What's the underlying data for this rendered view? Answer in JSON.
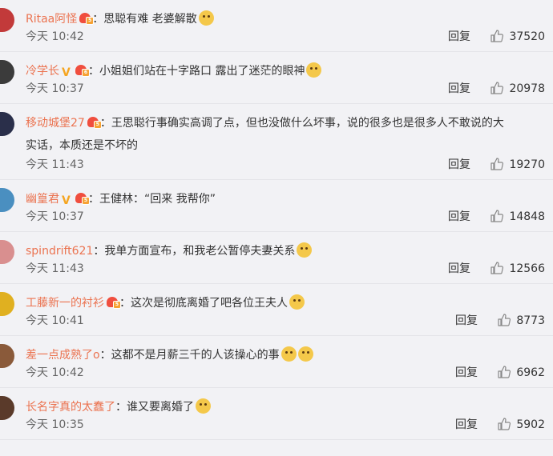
{
  "reply_label": "回复",
  "comments": [
    {
      "user": "Ritaa阿怪",
      "vip": true,
      "vip_level": "5",
      "verified": false,
      "text": "思聪有难 老婆解散",
      "emojis": 1,
      "time": "今天 10:42",
      "likes": "37520",
      "avatar_color": "#c23a3a"
    },
    {
      "user": "冷学长",
      "vip": true,
      "vip_level": "6",
      "verified": true,
      "text": "小姐姐们站在十字路口 露出了迷茫的眼神",
      "emojis": 1,
      "time": "今天 10:37",
      "likes": "20978",
      "avatar_color": "#3b3b3b"
    },
    {
      "user": "移动城堡27",
      "vip": true,
      "vip_level": "5",
      "verified": false,
      "text": "王思聪行事确实高调了点，但也没做什么坏事，说的很多也是很多人不敢说的大",
      "text2": "实话，本质还是不坏的",
      "emojis": 0,
      "time": "今天 11:43",
      "likes": "19270",
      "avatar_color": "#2a2f4a"
    },
    {
      "user": "幽篁君",
      "vip": true,
      "vip_level": "5",
      "verified": true,
      "text": "王健林：“回来 我帮你”",
      "emojis": 0,
      "time": "今天 10:37",
      "likes": "14848",
      "avatar_color": "#4a8fc0"
    },
    {
      "user": "spindrift621",
      "vip": false,
      "vip_level": "",
      "verified": false,
      "text": "我单方面宣布，和我老公暂停夫妻关系",
      "emojis": 1,
      "time": "今天 11:43",
      "likes": "12566",
      "avatar_color": "#d98f8f"
    },
    {
      "user": "工藤新一的衬衫",
      "vip": true,
      "vip_level": "5",
      "verified": false,
      "text": "这次是彻底离婚了吧各位王夫人",
      "emojis": 1,
      "time": "今天 10:41",
      "likes": "8773",
      "avatar_color": "#e0b020"
    },
    {
      "user": "差一点成熟了o",
      "vip": false,
      "vip_level": "",
      "verified": false,
      "text": "这都不是月薪三千的人该操心的事",
      "emojis": 2,
      "time": "今天 10:42",
      "likes": "6962",
      "avatar_color": "#8a5a3a"
    },
    {
      "user": "长名字真的太蠢了",
      "vip": false,
      "vip_level": "",
      "verified": false,
      "text": "谁又要离婚了",
      "emojis": 1,
      "time": "今天 10:35",
      "likes": "5902",
      "avatar_color": "#5a3a2a"
    }
  ]
}
